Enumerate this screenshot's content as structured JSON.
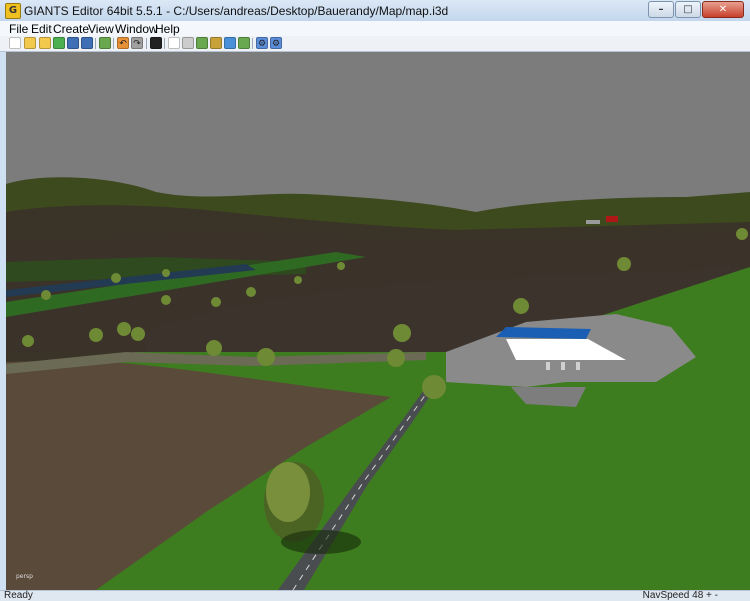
{
  "window": {
    "title": "GIANTS Editor 64bit 5.5.1 - C:/Users/andreas/Desktop/Bauerandy/Map/map.i3d",
    "minimize": "–",
    "maximize": "□",
    "close": "✕"
  },
  "menu": [
    "File",
    "Edit",
    "Create",
    "View",
    "Window",
    "Help"
  ],
  "toolbar": [
    {
      "name": "new-file-icon",
      "color": "#ffffff"
    },
    {
      "name": "open-folder-icon",
      "color": "#f2c94c"
    },
    {
      "name": "open-recent-icon",
      "color": "#f2c94c"
    },
    {
      "name": "reload-icon",
      "color": "#4caf50"
    },
    {
      "name": "save-icon",
      "color": "#3f6fb5"
    },
    {
      "name": "save-as-icon",
      "color": "#3f6fb5"
    },
    {
      "name": "import-icon",
      "color": "#6aa84f"
    },
    {
      "name": "undo-icon",
      "color": "#e69138"
    },
    {
      "name": "redo-icon",
      "color": "#a0a0a0"
    },
    {
      "name": "play-icon",
      "color": "#222222"
    },
    {
      "name": "select-tool-icon",
      "color": "#ffffff"
    },
    {
      "name": "move-tool-icon",
      "color": "#cccccc"
    },
    {
      "name": "terrain-sculpt-icon",
      "color": "#6aa84f"
    },
    {
      "name": "terrain-paint-icon",
      "color": "#c9a13b"
    },
    {
      "name": "foliage-paint-icon",
      "color": "#4a90d9"
    },
    {
      "name": "placeable-icon",
      "color": "#6aa84f"
    },
    {
      "name": "settings-gear-icon",
      "color": "#5b8dd9"
    },
    {
      "name": "scripts-gear-icon",
      "color": "#5b8dd9"
    }
  ],
  "viewport": {
    "camera_label": "persp"
  },
  "status": {
    "left": "Ready",
    "right": "NavSpeed 48 + -"
  }
}
